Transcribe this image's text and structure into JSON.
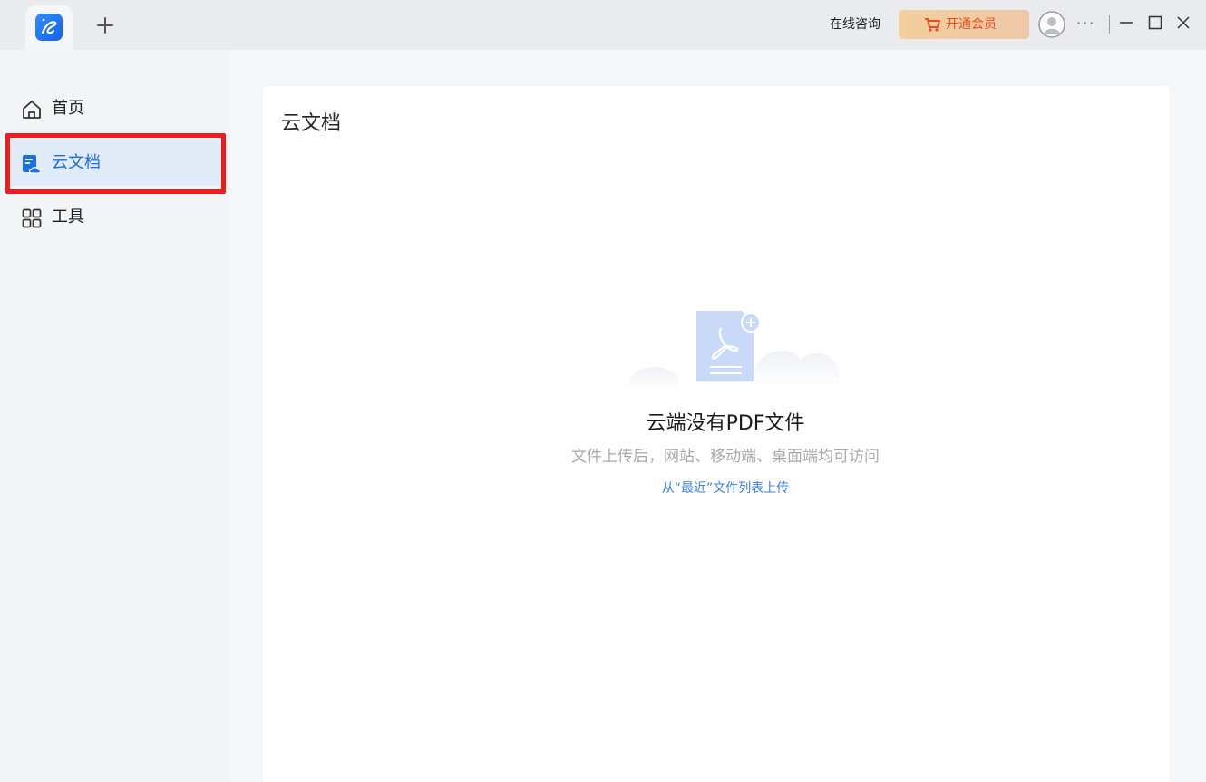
{
  "titlebar": {
    "consult_label": "在线咨询",
    "vip_label": "开通会员",
    "more_label": "···"
  },
  "sidebar": {
    "items": [
      {
        "label": "首页",
        "icon": "home-icon"
      },
      {
        "label": "云文档",
        "icon": "cloud-doc-icon",
        "active": true
      },
      {
        "label": "工具",
        "icon": "grid-tools-icon"
      }
    ]
  },
  "main": {
    "title": "云文档",
    "empty": {
      "title": "云端没有PDF文件",
      "description": "文件上传后，网站、移动端、桌面端均可访问",
      "link": "从“最近”文件列表上传"
    }
  },
  "colors": {
    "accent": "#1a6fe8",
    "highlight": "#ee1c1c",
    "vip_text": "#e64d1f"
  }
}
